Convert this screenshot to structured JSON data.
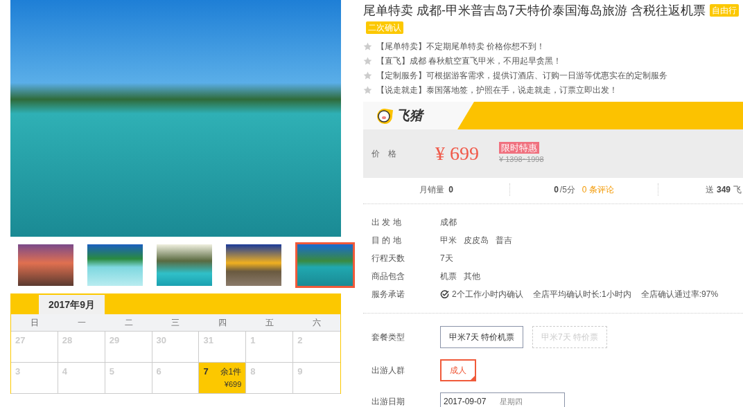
{
  "gallery": {
    "thumbnails": [
      {
        "selected": false
      },
      {
        "selected": false
      },
      {
        "selected": false
      },
      {
        "selected": false
      },
      {
        "selected": true
      }
    ]
  },
  "calendar": {
    "month_tab": "2017年9月",
    "weekdays": [
      "日",
      "一",
      "二",
      "三",
      "四",
      "五",
      "六"
    ],
    "weeks": [
      [
        {
          "day": "27",
          "available": false
        },
        {
          "day": "28",
          "available": false
        },
        {
          "day": "29",
          "available": false
        },
        {
          "day": "30",
          "available": false
        },
        {
          "day": "31",
          "available": false
        },
        {
          "day": "1",
          "available": false
        },
        {
          "day": "2",
          "available": false
        }
      ],
      [
        {
          "day": "3",
          "available": false
        },
        {
          "day": "4",
          "available": false
        },
        {
          "day": "5",
          "available": false
        },
        {
          "day": "6",
          "available": false
        },
        {
          "day": "7",
          "available": true,
          "stock": "余1件",
          "price": "¥699"
        },
        {
          "day": "8",
          "available": false
        },
        {
          "day": "9",
          "available": false
        }
      ]
    ]
  },
  "product": {
    "title": "尾单特卖 成都-甲米普吉岛7天特价泰国海岛旅游 含税往返机票",
    "tags": [
      "自由行",
      "二次确认"
    ],
    "highlights": [
      {
        "tag": "【尾单特卖】",
        "text": "不定期尾单特卖 价格你想不到！"
      },
      {
        "tag": "【直飞】",
        "text": "成都 春秋航空直飞甲米，不用起早贪黑！"
      },
      {
        "tag": "【定制服务】",
        "text": "可根据游客需求，提供订酒店、订购一日游等优惠实在的定制服务"
      },
      {
        "tag": "【说走就走】",
        "text": "泰国落地签，护照在手，说走就走，订票立即出发！"
      }
    ]
  },
  "price_box": {
    "brand": "飞猪",
    "label": "价　格",
    "price": "¥ 699",
    "promo": "限时特惠",
    "original_price": "¥ 1398~1998"
  },
  "stats": {
    "sales_label": "月销量",
    "sales": "0",
    "score": "0",
    "score_suffix": "/5分",
    "reviews": "0 条评论",
    "points_prefix": "送",
    "points": "349",
    "points_suffix": "飞"
  },
  "details": [
    {
      "label": "出 发 地",
      "values": [
        "成都"
      ]
    },
    {
      "label": "目 的 地",
      "values": [
        "甲米",
        "皮皮岛",
        "普吉"
      ]
    },
    {
      "label": "行程天数",
      "values": [
        "7天"
      ]
    },
    {
      "label": "商品包含",
      "values": [
        "机票",
        "其他"
      ]
    },
    {
      "label": "服务承诺",
      "values": [
        "2个工作小时内确认",
        "全店平均确认时长:1小时内",
        "全店确认通过率:97%"
      ],
      "kind": "promise"
    }
  ],
  "options": [
    {
      "label": "套餐类型",
      "choices": [
        {
          "text": "甲米7天 特价机票",
          "selected": false,
          "disabled": false
        },
        {
          "text": "甲米7天 特价票",
          "selected": false,
          "disabled": true
        }
      ]
    },
    {
      "label": "出游人群",
      "choices": [
        {
          "text": "成人",
          "selected": true,
          "disabled": false
        }
      ]
    }
  ],
  "date_field": {
    "label": "出游日期",
    "value": "2017-09-07",
    "weekday": "星期四"
  }
}
